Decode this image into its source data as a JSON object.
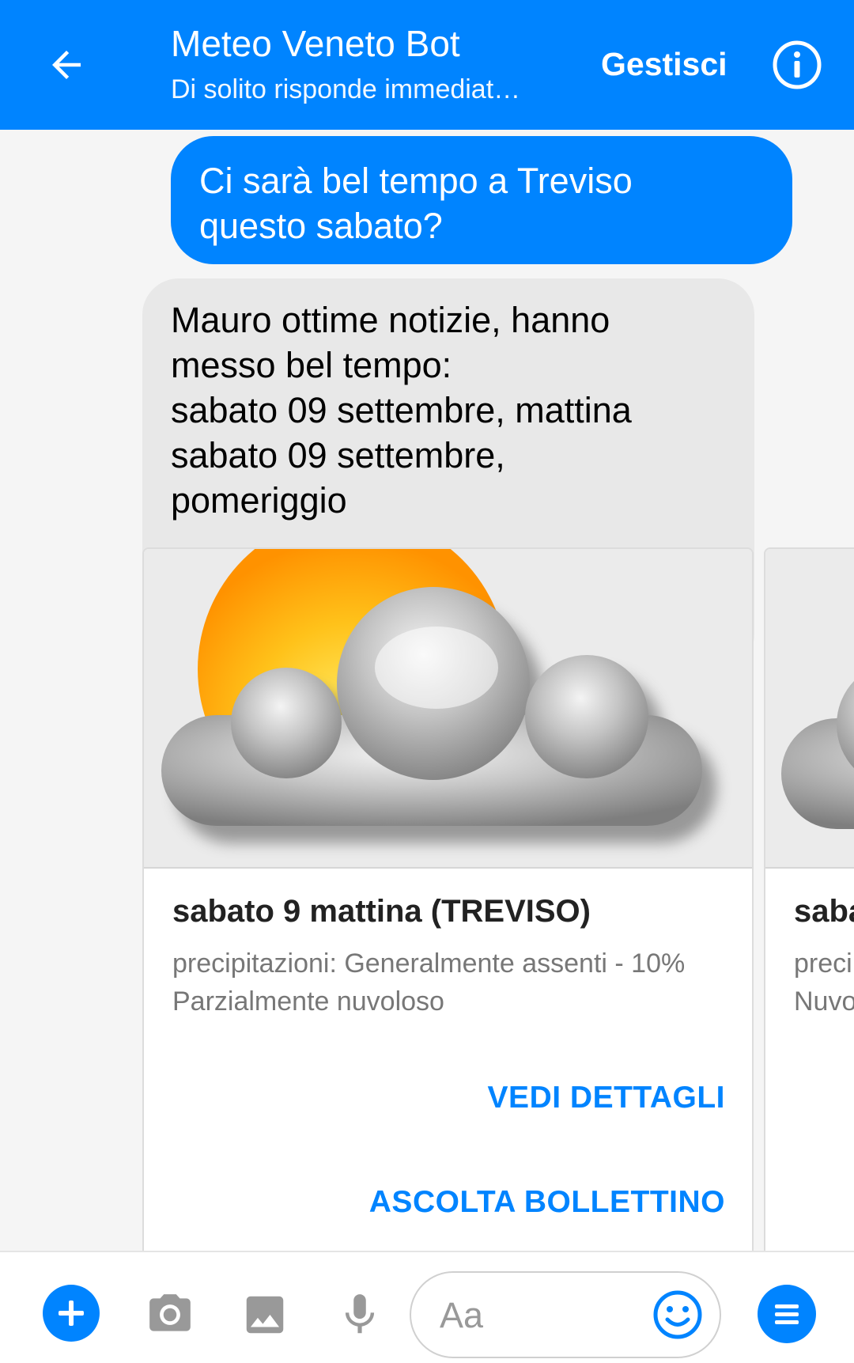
{
  "header": {
    "title": "Meteo Veneto Bot",
    "subtitle": "Di solito risponde immediat…",
    "manage_label": "Gestisci",
    "back_icon": "arrow-left-icon",
    "info_icon": "info-icon"
  },
  "messages": {
    "user": {
      "line1": "Ci sarà bel tempo a Treviso",
      "line2": "questo sabato?"
    },
    "bot": {
      "lines": [
        "Mauro ottime notizie, hanno",
        "messo bel tempo:",
        "sabato 09 settembre, mattina",
        "sabato 09 settembre,",
        "pomeriggio"
      ]
    }
  },
  "cards": [
    {
      "icon": "partly-cloudy-icon",
      "title": "sabato 9 mattina (TREVISO)",
      "line1": "precipitazioni: Generalmente assenti - 10%",
      "line2": "Parzialmente nuvoloso",
      "button1": "VEDI DETTAGLI",
      "button2": "ASCOLTA BOLLETTINO"
    },
    {
      "icon": "cloudy-icon",
      "title": "saba",
      "line1": "preci",
      "line2": "Nuvo"
    }
  ],
  "composer": {
    "placeholder": "Aa",
    "icons": [
      "plus-icon",
      "camera-icon",
      "image-icon",
      "microphone-icon",
      "emoji-icon",
      "menu-icon"
    ]
  },
  "colors": {
    "accent": "#0084ff",
    "bot_bubble": "#e8e8e8"
  }
}
